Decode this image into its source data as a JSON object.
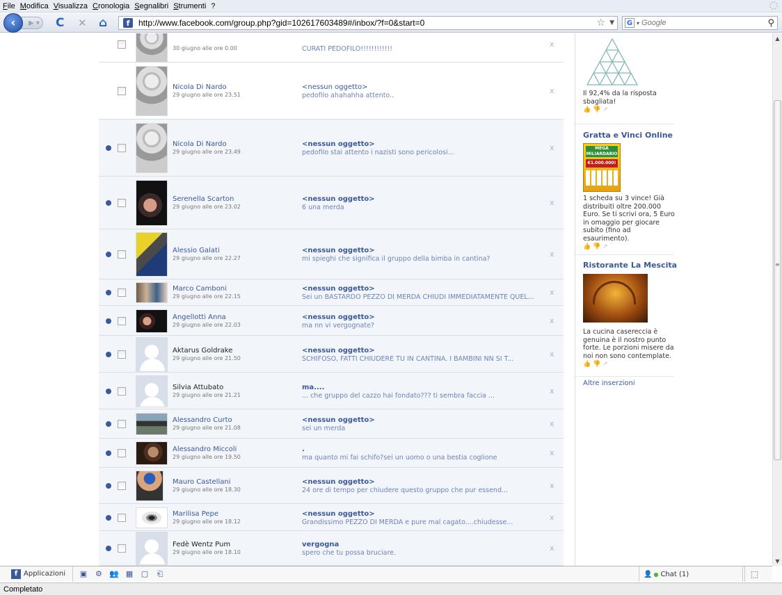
{
  "menu": [
    "File",
    "Modifica",
    "Visualizza",
    "Cronologia",
    "Segnalibri",
    "Strumenti",
    "?"
  ],
  "navbar": {
    "url": "http://www.facebook.com/group.php?gid=102617603489#/inbox/?f=0&start=0",
    "search_placeholder": "Google",
    "reload_icon": "C",
    "stop_icon": "✕",
    "home_icon": "⌂"
  },
  "messages": [
    {
      "sender": "",
      "date": "30 giugno alle ore 0.00",
      "subject": "",
      "snippet": "CURATI PEDOFILO!!!!!!!!!!!!",
      "unread": false,
      "photo": "gray"
    },
    {
      "sender": "Nicola Di Nardo",
      "date": "29 giugno alle ore 23.51",
      "subject": "<nessun oggetto>",
      "snippet": "pedofilo ahahahha attento..",
      "unread": false,
      "photo": "gray"
    },
    {
      "sender": "Nicola Di Nardo",
      "date": "29 giugno alle ore 23.49",
      "subject": "<nessun oggetto>",
      "snippet": "pedofilo stai attento i nazisti sono pericolosi...",
      "unread": true,
      "photo": "gray"
    },
    {
      "sender": "Serenella Scarton",
      "date": "29 giugno alle ore 23.02",
      "subject": "<nessun oggetto>",
      "snippet": "6 una merda",
      "unread": true,
      "photo": "dark"
    },
    {
      "sender": "Alessio Galati",
      "date": "29 giugno alle ore 22.27",
      "subject": "<nessun oggetto>",
      "snippet": "mi spieghi che significa il gruppo della bimba in cantina?",
      "unread": true,
      "photo": "yellow"
    },
    {
      "sender": "Marco Camboni",
      "date": "29 giugno alle ore 22.15",
      "subject": "<nessun oggetto>",
      "snippet": "Sei un BASTARDO PEZZO DI MERDA CHIUDI IMMEDIATAMENTE QUEL...",
      "unread": true,
      "photo": "group"
    },
    {
      "sender": "Angellotti Anna",
      "date": "29 giugno alle ore 22.03",
      "subject": "<nessun oggetto>",
      "snippet": "ma nn vi vergognate?",
      "unread": true,
      "photo": "couple"
    },
    {
      "sender": "Aktarus Goldrake",
      "date": "29 giugno alle ore 21.50",
      "subject": "<nessun oggetto>",
      "snippet": "SCHIFOSO, FATTI CHIUDERE TU IN CANTINA. I BAMBINI NN SI T...",
      "unread": true,
      "photo": "placeholder"
    },
    {
      "sender": "Silvia Attubato",
      "date": "29 giugno alle ore 21.21",
      "subject": "ma....",
      "snippet": "... che gruppo del cazzo hai fondato??? ti sembra faccia ...",
      "unread": true,
      "photo": "placeholder"
    },
    {
      "sender": "Alessandro Curto",
      "date": "29 giugno alle ore 21.08",
      "subject": "<nessun oggetto>",
      "snippet": "sei un merda",
      "unread": true,
      "photo": "moto"
    },
    {
      "sender": "Alessandro Miccoli",
      "date": "29 giugno alle ore 19.50",
      "subject": ".",
      "snippet": "ma quanto mi fai schifo?sei un uomo o una bestia coglione",
      "unread": true,
      "photo": "face"
    },
    {
      "sender": "Mauro Castellani",
      "date": "29 giugno alle ore 18.30",
      "subject": "<nessun oggetto>",
      "snippet": "24 ore di tempo per chiudere questo gruppo che pur essend...",
      "unread": true,
      "photo": "cap"
    },
    {
      "sender": "Marilisa Pepe",
      "date": "29 giugno alle ore 18.12",
      "subject": "<nessun oggetto>",
      "snippet": "Grandissimo PEZZO DI MERDA e pure mal cagato....chiudesse...",
      "unread": true,
      "photo": "eye"
    },
    {
      "sender": "Fedè Wentz Pum",
      "date": "29 giugno alle ore 18.10",
      "subject": "vergogna",
      "snippet": "spero che tu possa bruciare.",
      "unread": true,
      "photo": "placeholder"
    }
  ],
  "delete_glyph": "x",
  "ads": [
    {
      "title": "",
      "text": "Il 92,4% da la risposta sbagliata!",
      "image": "triangle"
    },
    {
      "title": "Gratta e Vinci Online",
      "text": "1 scheda su 3 vince! Già distribuiti oltre 200.000 Euro. Se ti scrivi ora, 5 Euro in omaggio per giocare subito (fino ad esaurimento).",
      "image": "ticket",
      "image_text": [
        "MEGA",
        "MILIARDARIO",
        "€1.000.000!"
      ]
    },
    {
      "title": "Ristorante La Mescita",
      "text": "La cucina casereccia è genuina è il nostro punto forte. Le porzioni misere da noi non sono contemplate.",
      "image": "restaurant"
    }
  ],
  "ads_more": "Altre inserzioni",
  "fbbar": {
    "apps_label": "Applicazioni",
    "chat_label": "Chat (1)"
  },
  "status": "Completato",
  "colors": {
    "fb_blue": "#3b5998",
    "link": "#6d84b4",
    "unread_bg": "#f2f5fa"
  }
}
